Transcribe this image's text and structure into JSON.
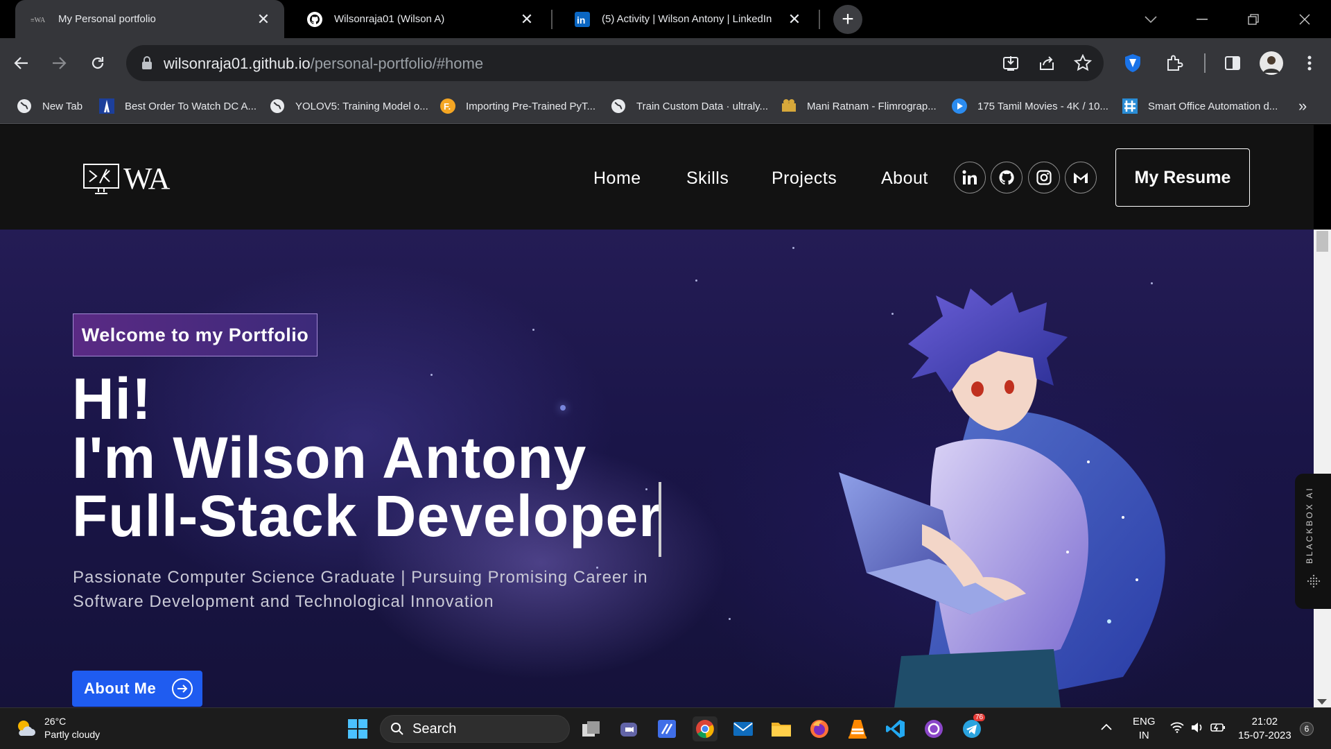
{
  "browser": {
    "tabs": [
      {
        "title": "My Personal portfolio",
        "active": true
      },
      {
        "title": "Wilsonraja01 (Wilson A)",
        "active": false
      },
      {
        "title": "(5) Activity | Wilson Antony | LinkedIn",
        "active": false
      }
    ],
    "url_host": "wilsonraja01.github.io",
    "url_path": "/personal-portfolio/#home",
    "bookmarks": [
      {
        "label": "New Tab",
        "icon": "globe-icon"
      },
      {
        "label": "Best Order To Watch DC A...",
        "icon": "dc-icon"
      },
      {
        "label": "YOLOV5: Training Model o...",
        "icon": "globe-icon"
      },
      {
        "label": "Importing Pre-Trained PyT...",
        "icon": "f-icon"
      },
      {
        "label": "Train Custom Data · ultraly...",
        "icon": "globe-icon"
      },
      {
        "label": "Mani Ratnam - Flimrograp...",
        "icon": "film-icon"
      },
      {
        "label": "175 Tamil Movies - 4K / 10...",
        "icon": "play-icon"
      },
      {
        "label": "Smart Office Automation d...",
        "icon": "hashnode-icon"
      }
    ]
  },
  "site": {
    "logo_text": "WA",
    "nav": [
      "Home",
      "Skills",
      "Projects",
      "About"
    ],
    "socials": [
      "linkedin-icon",
      "github-icon",
      "instagram-icon",
      "gmail-icon"
    ],
    "resume_label": "My Resume"
  },
  "hero": {
    "badge": "Welcome to my Portfolio",
    "line1": "Hi!",
    "line2": "I'm Wilson Antony",
    "line3": "Full-Stack Developer",
    "subtitle": "Passionate Computer Science Graduate | Pursuing Promising Career in Software Development and Technological Innovation",
    "button": "About Me"
  },
  "blackbox_label": "BLACKBOX AI",
  "taskbar": {
    "temperature": "26°C",
    "condition": "Partly cloudy",
    "search_placeholder": "Search",
    "lang_top": "ENG",
    "lang_bottom": "IN",
    "time": "21:02",
    "date": "15-07-2023",
    "notif_count": "6",
    "telegram_badge": "76"
  },
  "colors": {
    "accent_button": "#1f5cf0",
    "badge_bg": "#5a2a84",
    "header_bg": "#121212"
  }
}
